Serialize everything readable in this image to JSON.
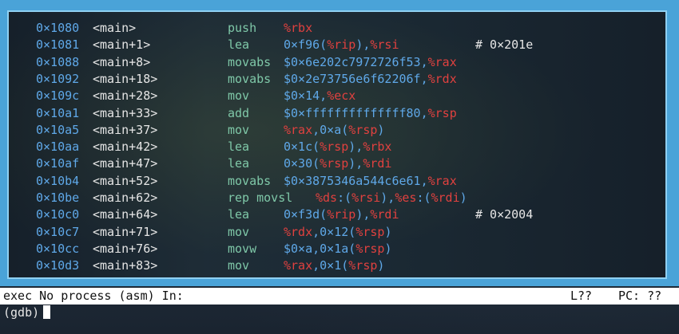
{
  "colors": {
    "frame": "#4aa3d8",
    "address": "#5fa8e8",
    "mnemonic": "#7fc8a8",
    "register": "#e0413f",
    "text": "#e6e6e6"
  },
  "asm": {
    "lines": [
      {
        "addr": "0×1080",
        "sym": "<main>",
        "mnem": "push",
        "ops": [
          {
            "t": "%rbx",
            "r": true
          }
        ],
        "comment": ""
      },
      {
        "addr": "0×1081",
        "sym": "<main+1>",
        "mnem": "lea",
        "ops": [
          {
            "t": "0×f96(",
            "r": false
          },
          {
            "t": "%rip",
            "r": true
          },
          {
            "t": "),",
            "r": false
          },
          {
            "t": "%rsi",
            "r": true
          }
        ],
        "comment": "# 0×201e"
      },
      {
        "addr": "0×1088",
        "sym": "<main+8>",
        "mnem": "movabs",
        "ops": [
          {
            "t": "$0×6e202c7972726f53,",
            "r": false
          },
          {
            "t": "%rax",
            "r": true
          }
        ],
        "comment": ""
      },
      {
        "addr": "0×1092",
        "sym": "<main+18>",
        "mnem": "movabs",
        "ops": [
          {
            "t": "$0×2e73756e6f62206f,",
            "r": false
          },
          {
            "t": "%rdx",
            "r": true
          }
        ],
        "comment": ""
      },
      {
        "addr": "0×109c",
        "sym": "<main+28>",
        "mnem": "mov",
        "ops": [
          {
            "t": "$0×14,",
            "r": false
          },
          {
            "t": "%ecx",
            "r": true
          }
        ],
        "comment": ""
      },
      {
        "addr": "0×10a1",
        "sym": "<main+33>",
        "mnem": "add",
        "ops": [
          {
            "t": "$0×ffffffffffffff80,",
            "r": false
          },
          {
            "t": "%rsp",
            "r": true
          }
        ],
        "comment": ""
      },
      {
        "addr": "0×10a5",
        "sym": "<main+37>",
        "mnem": "mov",
        "ops": [
          {
            "t": "%rax",
            "r": true
          },
          {
            "t": ",0×a(",
            "r": false
          },
          {
            "t": "%rsp",
            "r": true
          },
          {
            "t": ")",
            "r": false
          }
        ],
        "comment": ""
      },
      {
        "addr": "0×10aa",
        "sym": "<main+42>",
        "mnem": "lea",
        "ops": [
          {
            "t": "0×1c(",
            "r": false
          },
          {
            "t": "%rsp",
            "r": true
          },
          {
            "t": "),",
            "r": false
          },
          {
            "t": "%rbx",
            "r": true
          }
        ],
        "comment": ""
      },
      {
        "addr": "0×10af",
        "sym": "<main+47>",
        "mnem": "lea",
        "ops": [
          {
            "t": "0×30(",
            "r": false
          },
          {
            "t": "%rsp",
            "r": true
          },
          {
            "t": "),",
            "r": false
          },
          {
            "t": "%rdi",
            "r": true
          }
        ],
        "comment": ""
      },
      {
        "addr": "0×10b4",
        "sym": "<main+52>",
        "mnem": "movabs",
        "ops": [
          {
            "t": "$0×3875346a544c6e61,",
            "r": false
          },
          {
            "t": "%rax",
            "r": true
          }
        ],
        "comment": ""
      },
      {
        "addr": "0×10be",
        "sym": "<main+62>",
        "mnem": "rep movsl",
        "ops": [
          {
            "t": "%ds",
            "r": true
          },
          {
            "t": ":(",
            "r": false
          },
          {
            "t": "%rsi",
            "r": true
          },
          {
            "t": "),",
            "r": false
          },
          {
            "t": "%es",
            "r": true
          },
          {
            "t": ":(",
            "r": false
          },
          {
            "t": "%rdi",
            "r": true
          },
          {
            "t": ")",
            "r": false
          }
        ],
        "comment": ""
      },
      {
        "addr": "0×10c0",
        "sym": "<main+64>",
        "mnem": "lea",
        "ops": [
          {
            "t": "0×f3d(",
            "r": false
          },
          {
            "t": "%rip",
            "r": true
          },
          {
            "t": "),",
            "r": false
          },
          {
            "t": "%rdi",
            "r": true
          }
        ],
        "comment": "# 0×2004"
      },
      {
        "addr": "0×10c7",
        "sym": "<main+71>",
        "mnem": "mov",
        "ops": [
          {
            "t": "%rdx",
            "r": true
          },
          {
            "t": ",0×12(",
            "r": false
          },
          {
            "t": "%rsp",
            "r": true
          },
          {
            "t": ")",
            "r": false
          }
        ],
        "comment": ""
      },
      {
        "addr": "0×10cc",
        "sym": "<main+76>",
        "mnem": "movw",
        "ops": [
          {
            "t": "$0×a,0×1a(",
            "r": false
          },
          {
            "t": "%rsp",
            "r": true
          },
          {
            "t": ")",
            "r": false
          }
        ],
        "comment": ""
      },
      {
        "addr": "0×10d3",
        "sym": "<main+83>",
        "mnem": "mov",
        "ops": [
          {
            "t": "%rax",
            "r": true
          },
          {
            "t": ",0×1(",
            "r": false
          },
          {
            "t": "%rsp",
            "r": true
          },
          {
            "t": ")",
            "r": false
          }
        ],
        "comment": ""
      }
    ]
  },
  "status": {
    "left": "exec No process (asm) In:",
    "line": "L??",
    "pc": "PC: ??"
  },
  "command": {
    "prompt": "(gdb)"
  }
}
